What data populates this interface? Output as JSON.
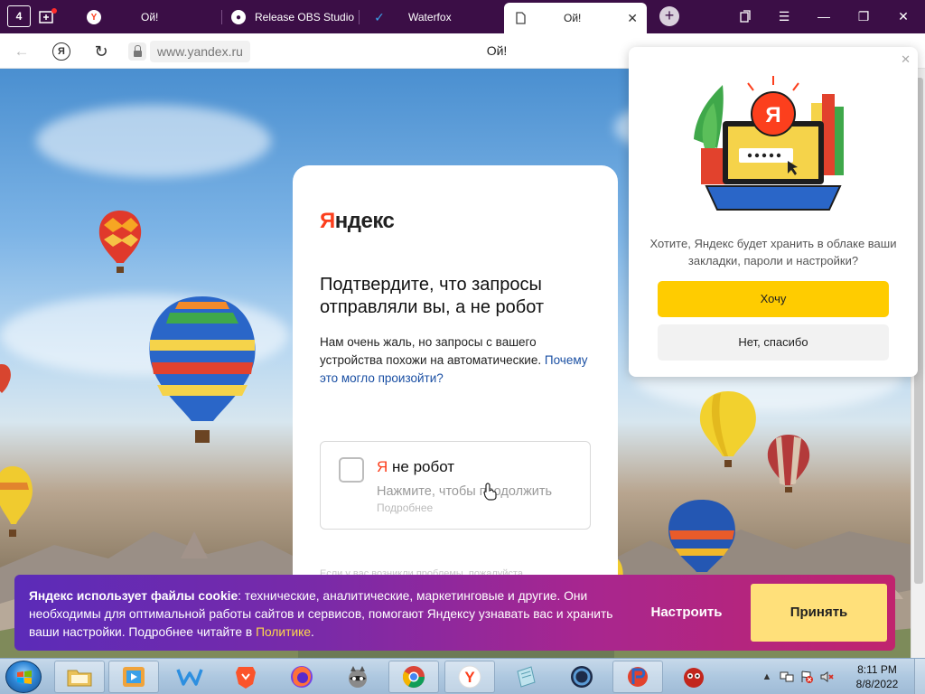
{
  "browser": {
    "home_tab_count": "4",
    "tabs": [
      {
        "title": "Ой!",
        "icon": "yandex-icon"
      },
      {
        "title": "Release OBS Studio",
        "icon": "github-icon"
      },
      {
        "title": "Waterfox",
        "icon": "waterfox-icon"
      },
      {
        "title": "Ой!",
        "icon": "document-icon",
        "active": true
      }
    ],
    "url": "www.yandex.ru",
    "page_title": "Ой!"
  },
  "captcha": {
    "logo_first": "Я",
    "logo_rest": "ндекс",
    "heading": "Подтвердите, что запросы отправляли вы, а не робот",
    "desc": "Нам очень жаль, но запросы с вашего устройства похожи на автоматические.",
    "desc_link": "Почему это могло произойти?",
    "checkbox_ya": "Я",
    "checkbox_label": " не робот",
    "checkbox_hint": "Нажмите, чтобы продолжить",
    "checkbox_more": "Подробнее",
    "footer": "Если у вас возникли проблемы, пожалуйста"
  },
  "popup": {
    "text": "Хотите, Яндекс будет хранить в облаке ваши закладки, пароли и настройки?",
    "yes": "Хочу",
    "no": "Нет, спасибо"
  },
  "cookie": {
    "bold": "Яндекс использует файлы cookie",
    "text": ": технические, аналитические, маркетинговые и другие. Они необходимы для оптимальной работы сайтов и сервисов, помогают Яндексу узнавать вас и хранить ваши настройки. Подробнее читайте в ",
    "link": "Политике",
    "end": ".",
    "setup": "Настроить",
    "accept": "Принять"
  },
  "taskbar": {
    "time": "8:11 PM",
    "date": "8/8/2022",
    "apps": [
      "file-explorer-icon",
      "media-player-icon",
      "waterfox-icon",
      "brave-icon",
      "firefox-icon",
      "raccoon-icon",
      "chrome-icon",
      "yandex-browser-icon",
      "notepad-icon",
      "obs-icon",
      "paint-icon",
      "app-icon"
    ]
  },
  "colors": {
    "tabstrip": "#3b0e46",
    "yandex_red": "#fc3f1d",
    "accent_yellow": "#ffcc00"
  }
}
